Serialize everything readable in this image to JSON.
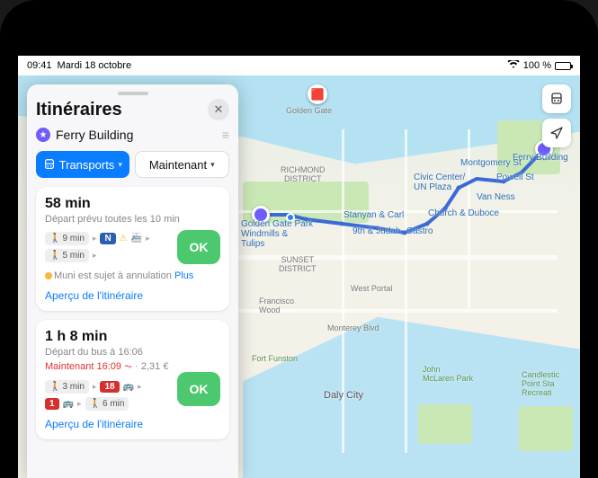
{
  "status": {
    "time": "09:41",
    "date": "Mardi 18 octobre",
    "battery_pct": "100 %"
  },
  "panel": {
    "title": "Itinéraires",
    "destination": "Ferry Building",
    "mode_chip": "Transports",
    "time_chip": "Maintenant",
    "go_label": "OK",
    "preview_label": "Aperçu de l'itinéraire"
  },
  "routes": [
    {
      "duration": "58 min",
      "subtitle": "Départ prévu toutes les 10 min",
      "step_a_walk": "9 min",
      "step_a_line": "N",
      "step_b_walk": "5 min",
      "alert": "Muni est sujet à annulation",
      "alert_more": "Plus"
    },
    {
      "duration": "1 h 8 min",
      "subtitle": "Départ du bus à 16:06",
      "now_label": "Maintenant 16:09",
      "price": "2,31 €",
      "step_a_walk": "3 min",
      "step_a_line": "18",
      "step_b_line": "1",
      "step_b_walk": "6 min"
    }
  ],
  "map": {
    "labels": {
      "golden_gate": "Golden Gate",
      "ferry_building": "Ferry Building",
      "powell": "Powell St",
      "montgomery": "Montgomery St",
      "civic_center": "Civic Center/\nUN Plaza",
      "van_ness": "Van Ness",
      "church_duboce": "Church & Duboce",
      "castro": "Castro",
      "stanyan_carl": "Stanyan & Carl",
      "ninth_judah": "9th & Judah",
      "ggp": "Golden Gate Park\nWindmills &\nTulips",
      "richmond": "RICHMOND\nDISTRICT",
      "sunset": "SUNSET\nDISTRICT",
      "francisco_wood": "Francisco\nWood",
      "monterey": "Monterey Blvd",
      "west_portal": "West Portal",
      "daly": "Daly City",
      "fort_funston": "Fort Funston",
      "john_mclaren": "John\nMcLaren Park",
      "candlestick": "Candlestic\nPoint Sta\nRecreati"
    }
  }
}
